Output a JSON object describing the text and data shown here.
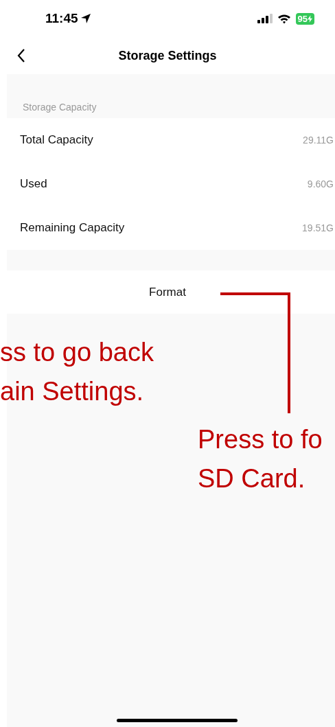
{
  "status_bar": {
    "time": "11:45",
    "battery": "95"
  },
  "nav": {
    "title": "Storage Settings"
  },
  "section": {
    "header": "Storage Capacity",
    "rows": [
      {
        "label": "Total Capacity",
        "value": "29.11G"
      },
      {
        "label": "Used",
        "value": "9.60G"
      },
      {
        "label": "Remaining Capacity",
        "value": "19.51G"
      }
    ]
  },
  "format_button": "Format",
  "annotations": [
    {
      "kind": "left",
      "lines": [
        "ss to go back",
        "ain Settings."
      ]
    },
    {
      "kind": "right",
      "lines": [
        "Press to fo",
        "SD Card."
      ]
    }
  ]
}
